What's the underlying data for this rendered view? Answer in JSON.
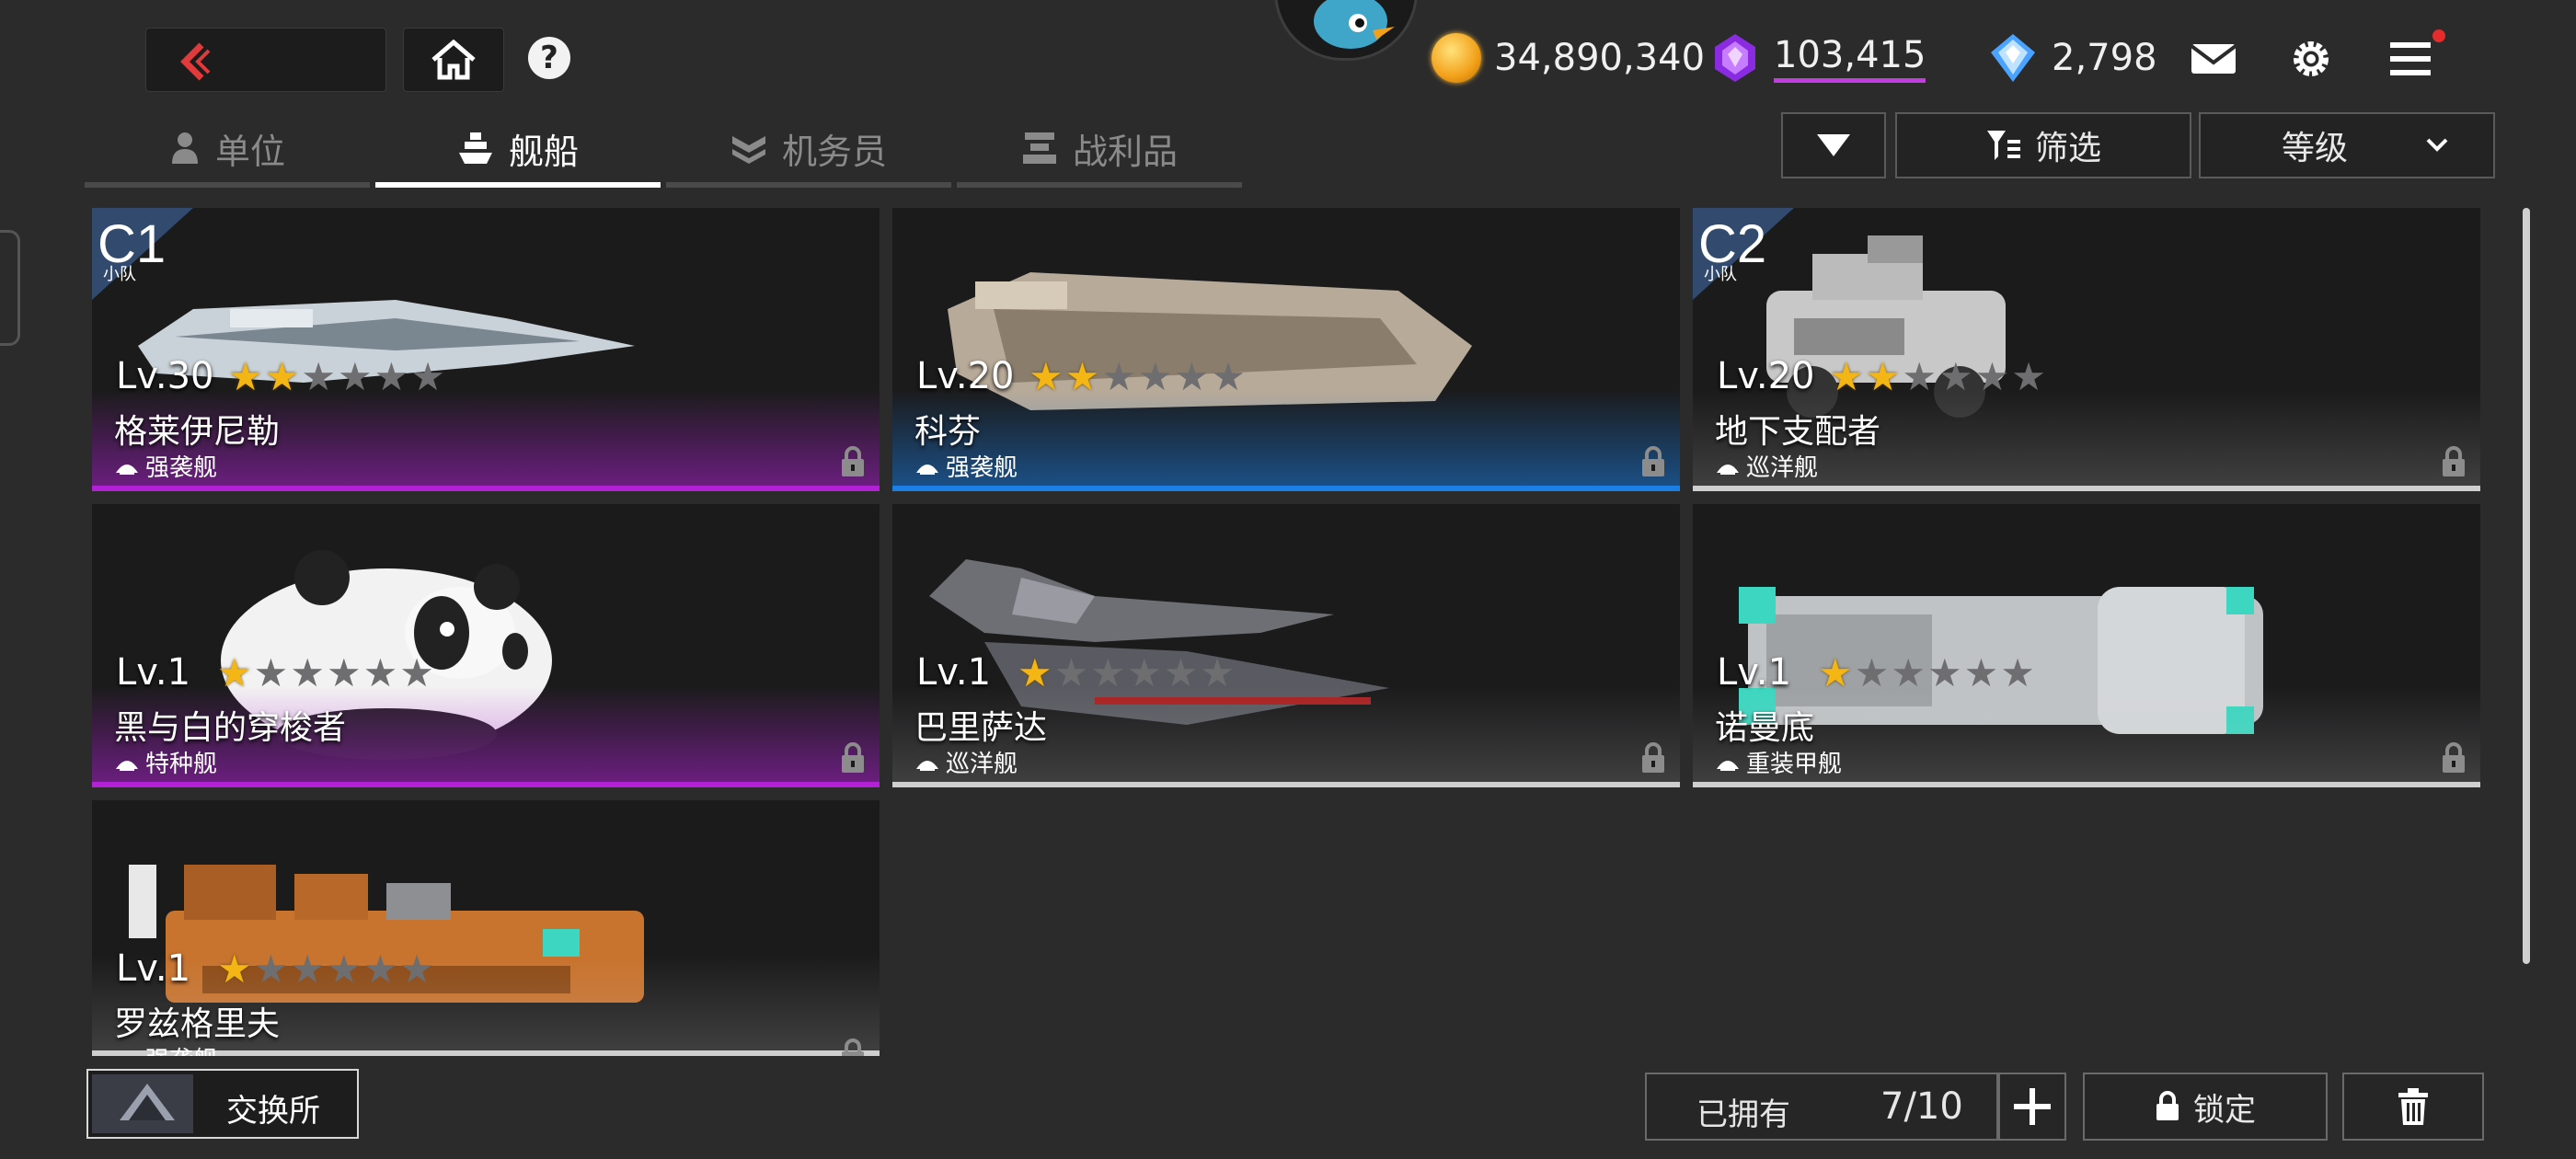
{
  "resources": [
    {
      "name": "gold-coin-icon",
      "value": "34,890,340"
    },
    {
      "name": "purple-crystal-icon",
      "value": "103,415"
    },
    {
      "name": "blue-diamond-icon",
      "value": "2,798"
    }
  ],
  "tabs": [
    {
      "label": "单位",
      "icon": "person-icon",
      "active": false
    },
    {
      "label": "舰船",
      "icon": "ship-icon",
      "active": true
    },
    {
      "label": "机务员",
      "icon": "crew-icon",
      "active": false
    },
    {
      "label": "战利品",
      "icon": "loot-icon",
      "active": false
    }
  ],
  "controls": {
    "filter_label": "筛选",
    "sort_label": "等级"
  },
  "cards": [
    {
      "level": "Lv.30",
      "stars": 2,
      "name": "格莱伊尼勒",
      "type": "强袭舰",
      "badge": "C1",
      "badge_sub": "小队",
      "rarity_color": "#b221d6"
    },
    {
      "level": "Lv.20",
      "stars": 2,
      "name": "科芬",
      "type": "强袭舰",
      "badge": "",
      "badge_sub": "",
      "rarity_color": "#1b7fe6"
    },
    {
      "level": "Lv.20",
      "stars": 2,
      "name": "地下支配者",
      "type": "巡洋舰",
      "badge": "C2",
      "badge_sub": "小队",
      "rarity_color": "#cfcfcf"
    },
    {
      "level": "Lv.1",
      "stars": 1,
      "name": "黑与白的穿梭者",
      "type": "特种舰",
      "badge": "",
      "badge_sub": "",
      "rarity_color": "#b221d6"
    },
    {
      "level": "Lv.1",
      "stars": 1,
      "name": "巴里萨达",
      "type": "巡洋舰",
      "badge": "",
      "badge_sub": "",
      "rarity_color": "#cfcfcf"
    },
    {
      "level": "Lv.1",
      "stars": 1,
      "name": "诺曼底",
      "type": "重装甲舰",
      "badge": "",
      "badge_sub": "",
      "rarity_color": "#cfcfcf"
    },
    {
      "level": "Lv.1",
      "stars": 1,
      "name": "罗兹格里夫",
      "type": "强袭舰",
      "badge": "",
      "badge_sub": "",
      "rarity_color": "#cfcfcf"
    }
  ],
  "bottom": {
    "exchange_label": "交换所",
    "owned_label": "已拥有",
    "owned_count": "7/10",
    "lock_label": "锁定"
  }
}
